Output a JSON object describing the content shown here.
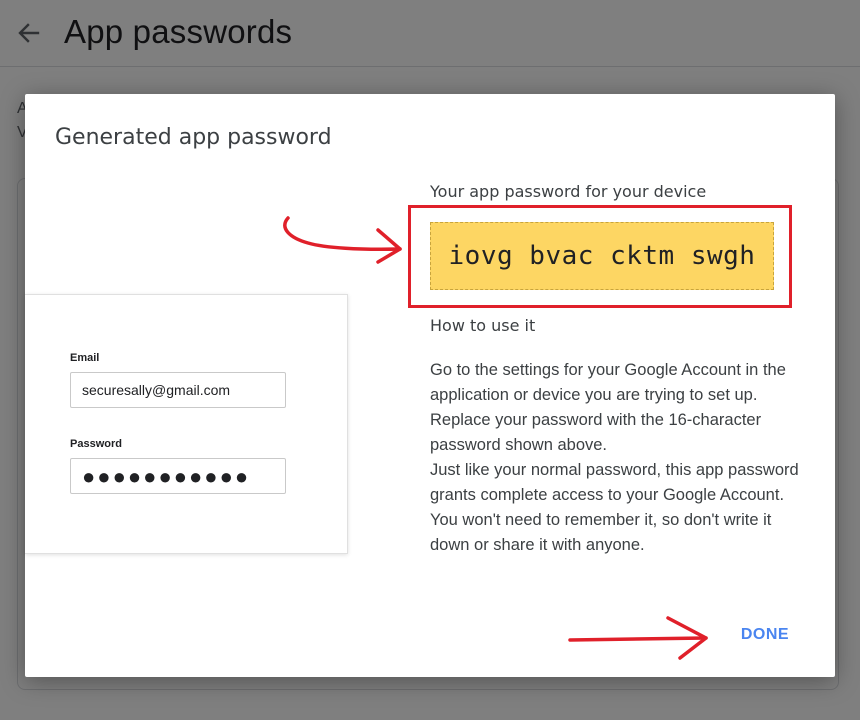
{
  "page": {
    "title": "App passwords",
    "bg_text_1": "A",
    "bg_text_2": "V"
  },
  "dialog": {
    "title": "Generated app password",
    "password_heading": "Your app password for your device",
    "password": "iovg bvac cktm swgh",
    "how_to_heading": "How to use it",
    "instructions_1": "Go to the settings for your Google Account in the application or device you are trying to set up. Replace your password with the 16-character password shown above.",
    "instructions_2": "Just like your normal password, this app password grants complete access to your Google Account. You won't need to remember it, so don't write it down or share it with anyone.",
    "done_label": "DONE"
  },
  "illustration": {
    "email_label": "Email",
    "email_value": "securesally@gmail.com",
    "password_label": "Password",
    "password_value": "●●●●●●●●●●●"
  },
  "icons": {
    "back": "arrow-back-icon"
  },
  "colors": {
    "overlay": "rgba(0,0,0,0.5)",
    "password_box": "#fdd663",
    "annotation_red": "#e0202a",
    "done_blue": "#4a85f0"
  }
}
